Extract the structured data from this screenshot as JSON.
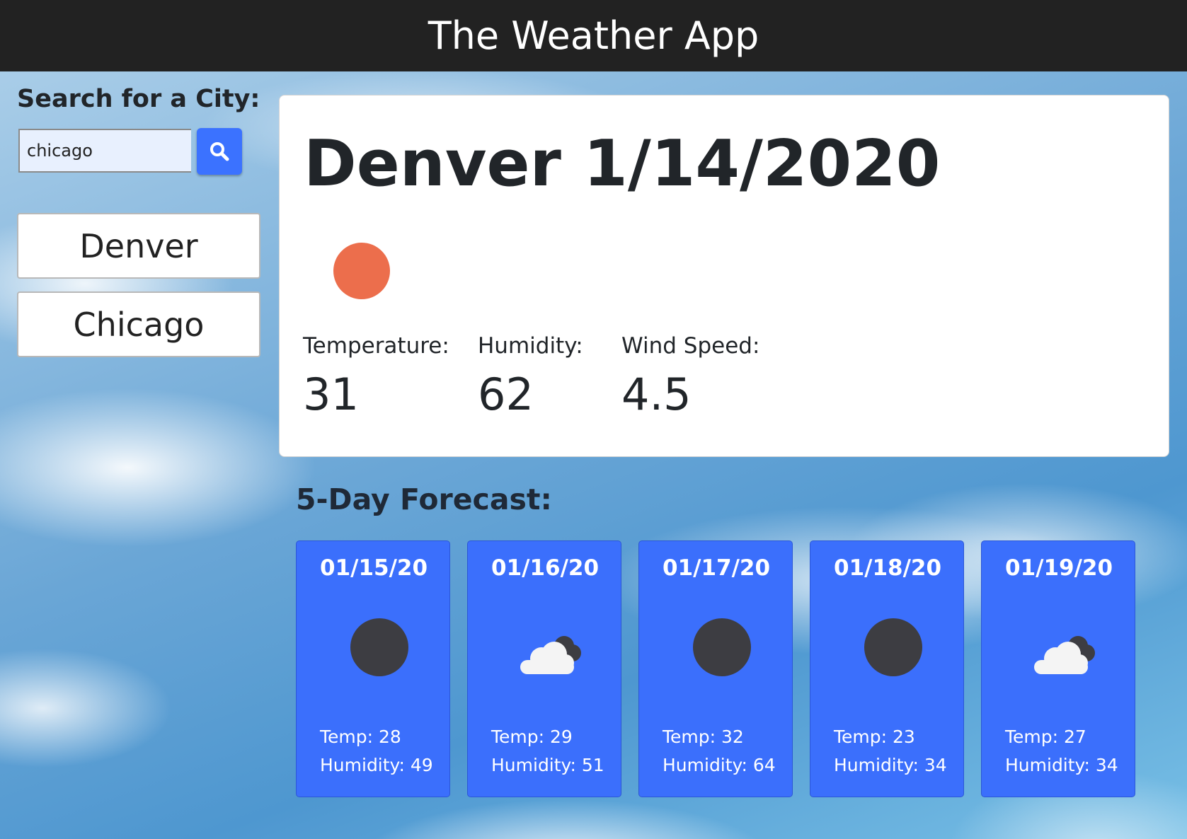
{
  "header": {
    "title": "The Weather App"
  },
  "search": {
    "label": "Search for a City:",
    "value": "chicago",
    "button_icon": "search-icon"
  },
  "history": [
    {
      "city": "Denver"
    },
    {
      "city": "Chicago"
    }
  ],
  "current": {
    "title": "Denver 1/14/2020",
    "icon": "sun-icon",
    "temperature_label": "Temperature:",
    "temperature": "31",
    "humidity_label": "Humidity:",
    "humidity": "62",
    "wind_label": "Wind Speed:",
    "wind": "4.5"
  },
  "forecast": {
    "title": "5-Day Forecast:",
    "days": [
      {
        "date": "01/15/20",
        "icon": "moon-icon",
        "temp": "Temp: 28",
        "humidity": "Humidity: 49"
      },
      {
        "date": "01/16/20",
        "icon": "cloudy-icon",
        "temp": "Temp: 29",
        "humidity": "Humidity: 51"
      },
      {
        "date": "01/17/20",
        "icon": "moon-icon",
        "temp": "Temp: 32",
        "humidity": "Humidity: 64"
      },
      {
        "date": "01/18/20",
        "icon": "moon-icon",
        "temp": "Temp: 23",
        "humidity": "Humidity: 34"
      },
      {
        "date": "01/19/20",
        "icon": "cloudy-icon",
        "temp": "Temp: 27",
        "humidity": "Humidity: 34"
      }
    ]
  },
  "colors": {
    "header_bg": "#222222",
    "accent_blue": "#3b6ffc",
    "sun": "#ec6e4c",
    "moon": "#3d3d42"
  }
}
